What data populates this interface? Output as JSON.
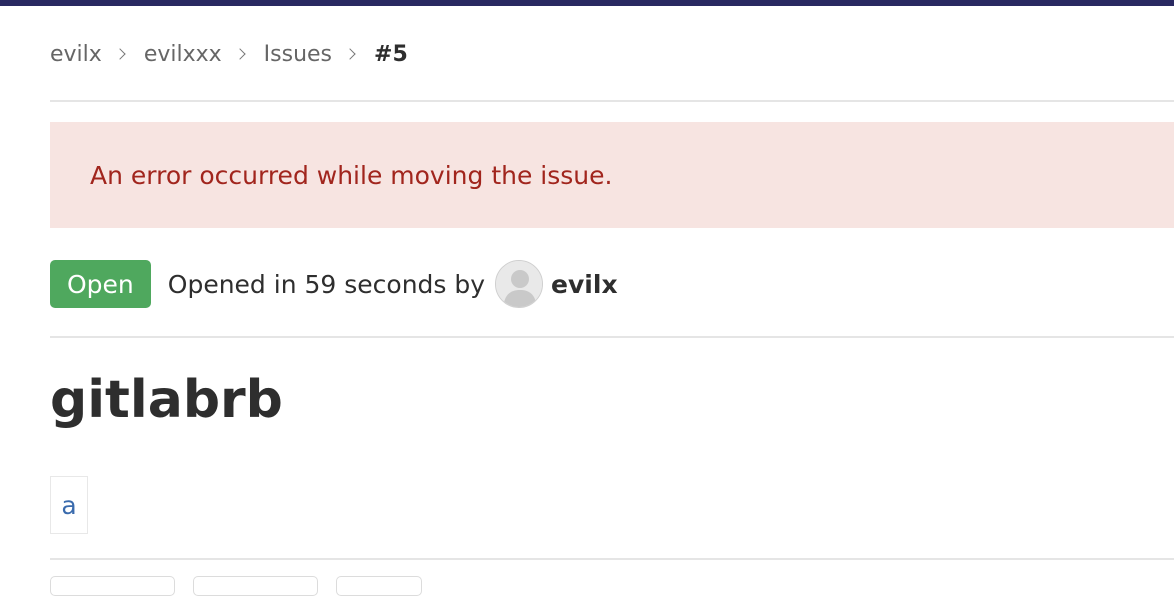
{
  "breadcrumb": {
    "items": [
      "evilx",
      "evilxxx",
      "Issues"
    ],
    "current": "#5"
  },
  "alert": {
    "message": "An error occurred while moving the issue."
  },
  "issue": {
    "status": "Open",
    "opened_text": "Opened in 59 seconds by",
    "author": "evilx",
    "title": "gitlabrb",
    "description": "a"
  },
  "colors": {
    "top_bar": "#292961",
    "alert_bg": "#f7e4e1",
    "alert_text": "#a1251d",
    "status_open": "#4fa85e",
    "link": "#3a6bad"
  },
  "icons": {
    "breadcrumb_separator": "chevron-right-icon",
    "avatar": "default-user-avatar-icon"
  }
}
